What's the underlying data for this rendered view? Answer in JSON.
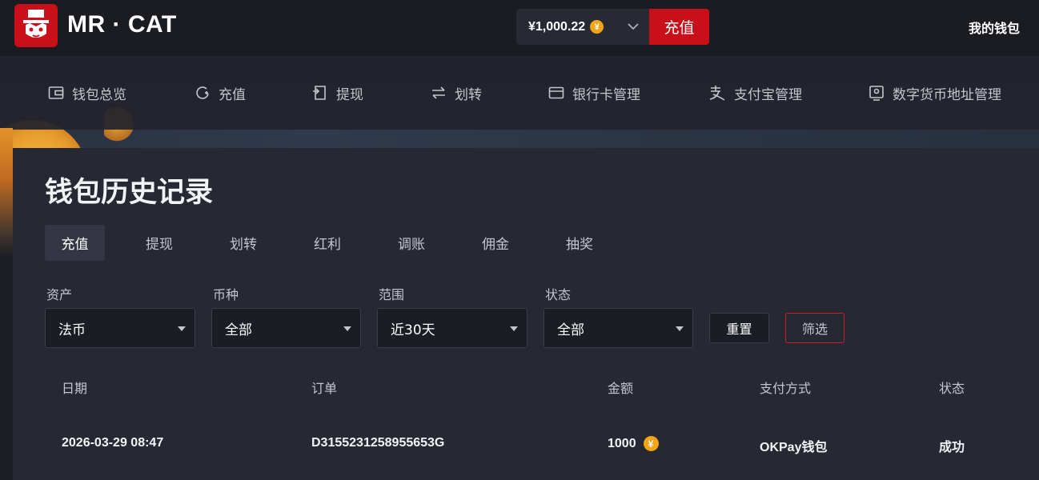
{
  "header": {
    "brand": "MR · CAT",
    "balance": "¥1,000.22",
    "coin_symbol": "¥",
    "recharge_label": "充值",
    "my_wallet": "我的钱包",
    "accent_color": "#c9101a"
  },
  "nav": {
    "items": [
      {
        "label": "钱包总览",
        "icon": "wallet-icon"
      },
      {
        "label": "充值",
        "icon": "recharge-icon"
      },
      {
        "label": "提现",
        "icon": "withdraw-icon"
      },
      {
        "label": "划转",
        "icon": "transfer-icon"
      },
      {
        "label": "银行卡管理",
        "icon": "bank-card-icon"
      },
      {
        "label": "支付宝管理",
        "icon": "alipay-icon"
      },
      {
        "label": "数字货币地址管理",
        "icon": "crypto-address-icon"
      }
    ]
  },
  "page": {
    "title": "钱包历史记录"
  },
  "tabs": [
    {
      "label": "充值",
      "active": true
    },
    {
      "label": "提现"
    },
    {
      "label": "划转"
    },
    {
      "label": "红利"
    },
    {
      "label": "调账"
    },
    {
      "label": "佣金"
    },
    {
      "label": "抽奖"
    }
  ],
  "filters": [
    {
      "label": "资产",
      "value": "法币"
    },
    {
      "label": "币种",
      "value": "全部"
    },
    {
      "label": "范围",
      "value": "近30天"
    },
    {
      "label": "状态",
      "value": "全部"
    }
  ],
  "buttons": {
    "reset": "重置",
    "filter": "筛选"
  },
  "table": {
    "columns": [
      "日期",
      "订单",
      "金额",
      "支付方式",
      "状态"
    ],
    "rows": [
      {
        "date": "2026-03-29 08:47",
        "order": "D3155231258955653G",
        "amount": "1000",
        "coin": "¥",
        "payment": "OKPay钱包",
        "status": "成功"
      }
    ]
  }
}
